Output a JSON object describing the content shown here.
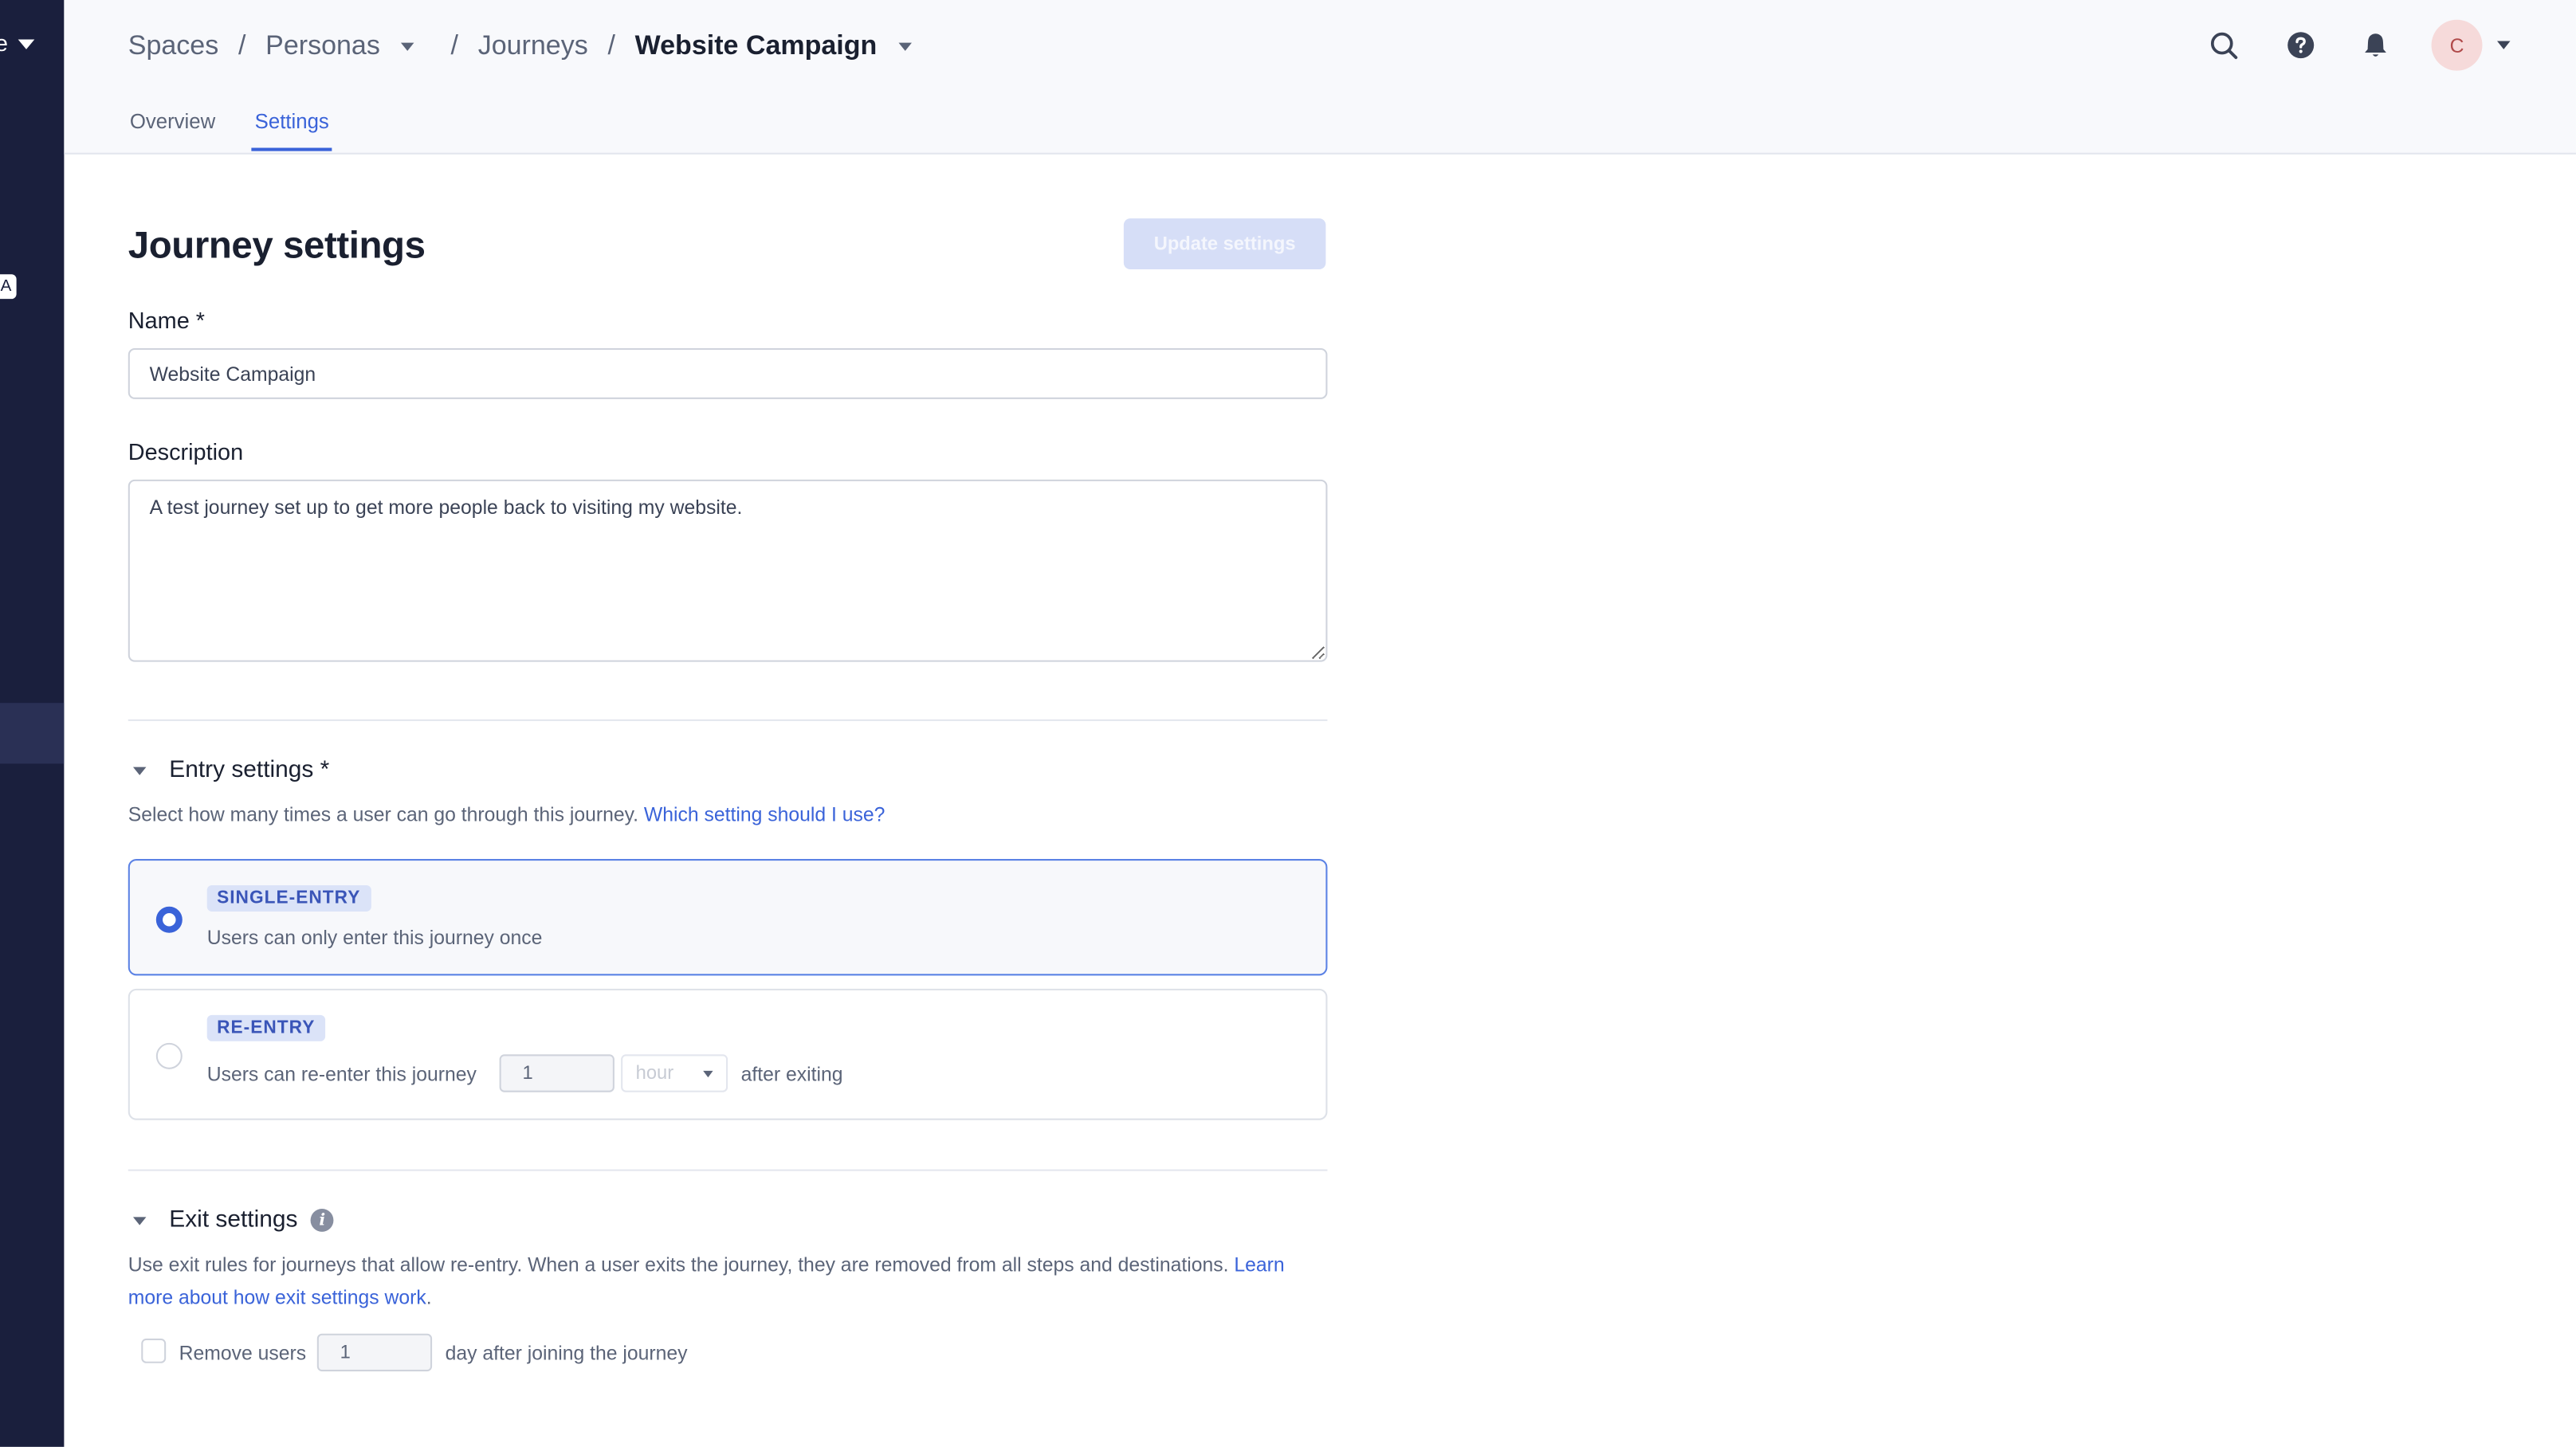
{
  "rail": {
    "text": "e",
    "badge": "A"
  },
  "breadcrumb": {
    "spaces": "Spaces",
    "personas": "Personas",
    "journeys": "Journeys",
    "current": "Website Campaign",
    "separator": "/"
  },
  "tabs": [
    {
      "label": "Overview",
      "active": false
    },
    {
      "label": "Settings",
      "active": true
    }
  ],
  "header_icons": [
    "search-icon",
    "help-icon",
    "bell-icon"
  ],
  "user": {
    "avatar_initial": "C"
  },
  "page": {
    "title": "Journey settings",
    "update_button": "Update settings"
  },
  "form": {
    "name_label": "Name *",
    "name_value": "Website Campaign",
    "description_label": "Description",
    "description_value": "A test journey set up to get more people back to visiting my website."
  },
  "entry_settings": {
    "heading": "Entry settings *",
    "help_text": "Select how many times a user can go through this journey.",
    "help_link": "Which setting should I use?",
    "single": {
      "badge": "SINGLE-ENTRY",
      "description": "Users can only enter this journey once",
      "selected": true
    },
    "reentry": {
      "badge": "RE-ENTRY",
      "description": "Users can re-enter this journey",
      "value": "1",
      "unit": "hour",
      "suffix": "after exiting",
      "selected": false
    }
  },
  "exit_settings": {
    "heading": "Exit settings",
    "help_text": "Use exit rules for journeys that allow re-entry. When a user exits the journey, they are removed from all steps and destinations.",
    "help_link": "Learn more about how exit settings work",
    "help_end": ".",
    "checkbox_label": "Remove users",
    "value": "1",
    "suffix": "day after joining the journey",
    "checked": false
  },
  "colors": {
    "accent": "#3a63d9",
    "rail": "#1a1f3d",
    "badge_bg": "#dbe3f8",
    "button_disabled": "#d6def7"
  }
}
